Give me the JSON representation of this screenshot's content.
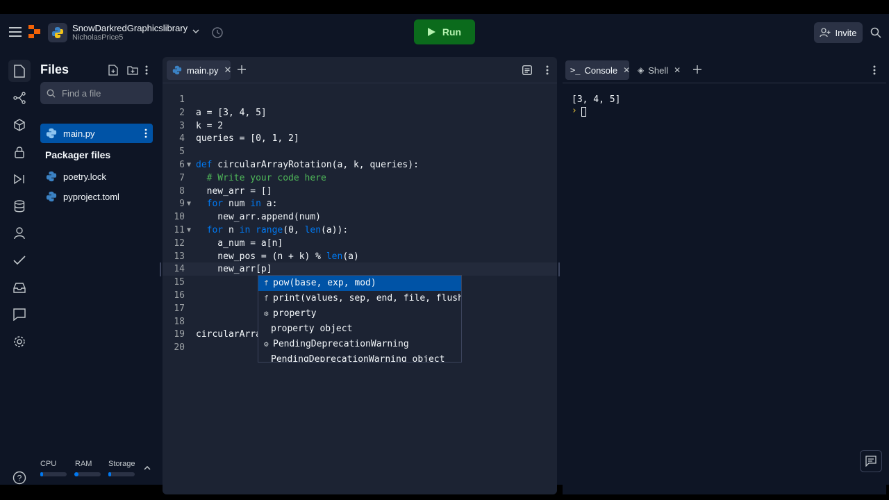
{
  "header": {
    "repl_name": "SnowDarkredGraphicslibrary",
    "owner": "NicholasPrice5",
    "run_label": "Run",
    "invite_label": "Invite"
  },
  "files": {
    "title": "Files",
    "search_placeholder": "Find a file",
    "items": [
      {
        "name": "main.py",
        "selected": true
      }
    ],
    "packager_title": "Packager files",
    "packager_items": [
      {
        "name": "poetry.lock"
      },
      {
        "name": "pyproject.toml"
      }
    ]
  },
  "resources": {
    "cpu_label": "CPU",
    "ram_label": "RAM",
    "storage_label": "Storage",
    "cpu_level": 0.1,
    "ram_level": 0.15,
    "storage_level": 0.1
  },
  "editor": {
    "tab_label": "main.py",
    "lines": [
      {
        "n": "1",
        "code": ""
      },
      {
        "n": "2",
        "code": "a = [3, 4, 5]"
      },
      {
        "n": "3",
        "code": "k = 2"
      },
      {
        "n": "4",
        "code": "queries = [0, 1, 2]"
      },
      {
        "n": "5",
        "code": ""
      },
      {
        "n": "6",
        "code": "def circularArrayRotation(a, k, queries):",
        "fold": true
      },
      {
        "n": "7",
        "code": "  # Write your code here"
      },
      {
        "n": "8",
        "code": "  new_arr = []"
      },
      {
        "n": "9",
        "code": "  for num in a:",
        "fold": true
      },
      {
        "n": "10",
        "code": "    new_arr.append(num)"
      },
      {
        "n": "11",
        "code": "  for n in range(0, len(a)):",
        "fold": true
      },
      {
        "n": "12",
        "code": "    a_num = a[n]"
      },
      {
        "n": "13",
        "code": "    new_pos = (n + k) % len(a)"
      },
      {
        "n": "14",
        "code": "    new_arr[p]"
      },
      {
        "n": "15",
        "code": ""
      },
      {
        "n": "16",
        "code": ""
      },
      {
        "n": "17",
        "code": ""
      },
      {
        "n": "18",
        "code": ""
      },
      {
        "n": "19",
        "code": "circularArra"
      },
      {
        "n": "20",
        "code": ""
      }
    ]
  },
  "autocomplete": [
    {
      "icon": "f",
      "text": "pow(base, exp, mod)",
      "selected": true
    },
    {
      "icon": "f",
      "text": "print(values, sep, end, file, flush)"
    },
    {
      "icon": "⚙",
      "text": "property"
    },
    {
      "icon": "",
      "text": "property object"
    },
    {
      "icon": "⚙",
      "text": "PendingDeprecationWarning"
    },
    {
      "icon": "",
      "text": "PendingDeprecationWarning object"
    }
  ],
  "console": {
    "tab_console": "Console",
    "tab_shell": "Shell",
    "output": "[3, 4, 5]",
    "prompt": "›"
  },
  "colors": {
    "accent": "#0079f2",
    "run_button": "#0b6b1c",
    "selected": "#0053a6"
  }
}
